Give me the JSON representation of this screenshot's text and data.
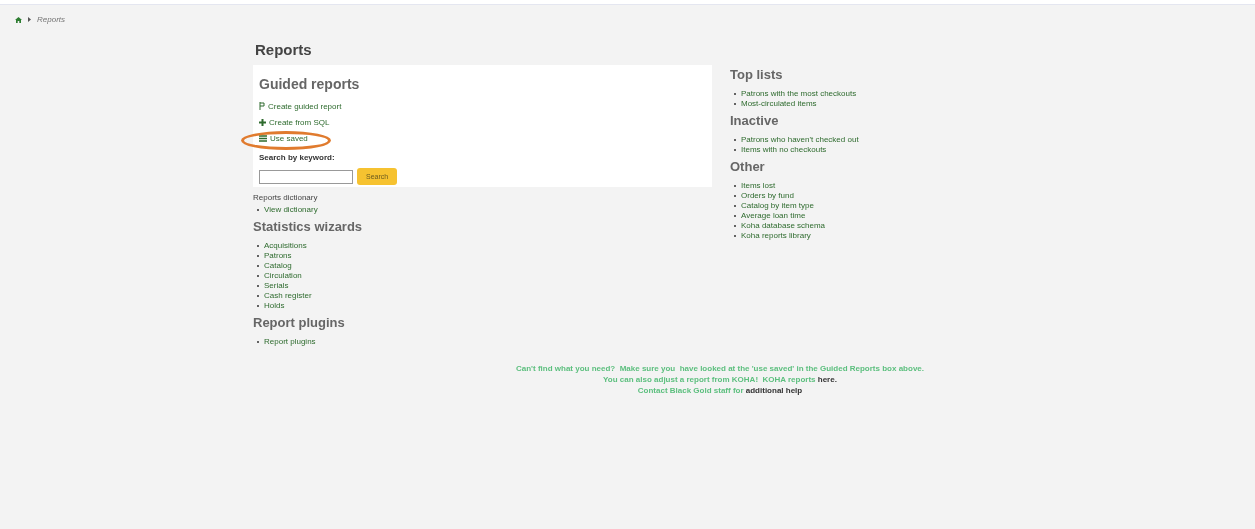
{
  "breadcrumb": {
    "current": "Reports"
  },
  "page_title": "Reports",
  "guided_reports": {
    "title": "Guided reports",
    "links": [
      {
        "kind": "wand",
        "label": "Create guided report"
      },
      {
        "kind": "plus",
        "label": "Create from SQL"
      },
      {
        "kind": "list",
        "label": "Use saved"
      }
    ],
    "search_label": "Search by keyword:",
    "search_button": "Search"
  },
  "dictionary": {
    "title": "Reports dictionary",
    "items": [
      "View dictionary"
    ]
  },
  "left_sections": [
    {
      "title": "Statistics wizards",
      "items": [
        "Acquisitions",
        "Patrons",
        "Catalog",
        "Circulation",
        "Serials",
        "Cash register",
        "Holds"
      ]
    },
    {
      "title": "Report plugins",
      "items": [
        "Report plugins"
      ]
    }
  ],
  "right_sections": [
    {
      "title": "Top lists",
      "items": [
        "Patrons with the most checkouts",
        "Most-circulated items"
      ]
    },
    {
      "title": "Inactive",
      "items": [
        "Patrons who haven't checked out",
        "Items with no checkouts"
      ]
    },
    {
      "title": "Other",
      "items": [
        "Items lost",
        "Orders by fund",
        "Catalog by item type",
        "Average loan time",
        "Koha database schema",
        "Koha reports library"
      ]
    }
  ],
  "footer": [
    {
      "text": "Can't find what you need?  Make sure you  have looked at the 'use saved' in the Guided Reports box above."
    },
    {
      "text": "You can also adjust a report from KOHA!  KOHA reports ",
      "link": "here."
    },
    {
      "text": "Contact Black Gold staff for ",
      "link": "additional help"
    }
  ]
}
